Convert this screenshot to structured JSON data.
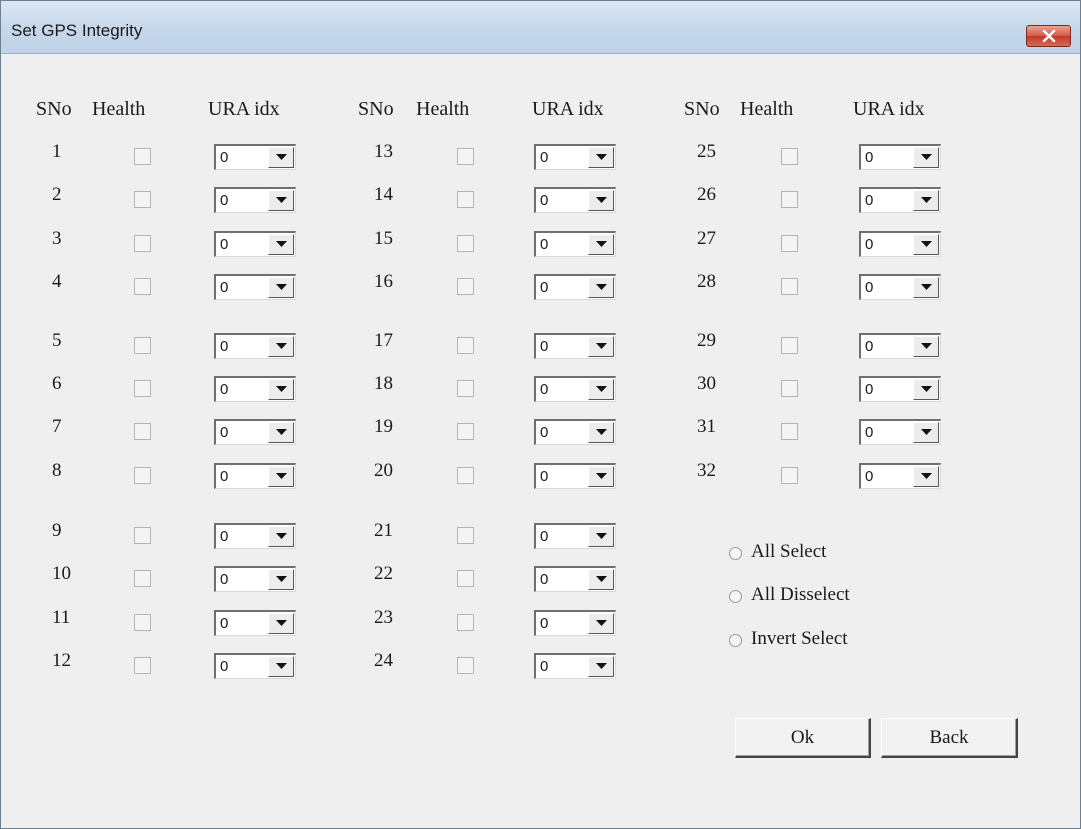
{
  "window": {
    "title": "Set GPS Integrity"
  },
  "headers": {
    "sno": "SNo",
    "health": "Health",
    "ura": "URA idx"
  },
  "satellites": [
    {
      "sno": "1",
      "health": false,
      "ura": "0"
    },
    {
      "sno": "2",
      "health": false,
      "ura": "0"
    },
    {
      "sno": "3",
      "health": false,
      "ura": "0"
    },
    {
      "sno": "4",
      "health": false,
      "ura": "0"
    },
    {
      "sno": "5",
      "health": false,
      "ura": "0"
    },
    {
      "sno": "6",
      "health": false,
      "ura": "0"
    },
    {
      "sno": "7",
      "health": false,
      "ura": "0"
    },
    {
      "sno": "8",
      "health": false,
      "ura": "0"
    },
    {
      "sno": "9",
      "health": false,
      "ura": "0"
    },
    {
      "sno": "10",
      "health": false,
      "ura": "0"
    },
    {
      "sno": "11",
      "health": false,
      "ura": "0"
    },
    {
      "sno": "12",
      "health": false,
      "ura": "0"
    },
    {
      "sno": "13",
      "health": false,
      "ura": "0"
    },
    {
      "sno": "14",
      "health": false,
      "ura": "0"
    },
    {
      "sno": "15",
      "health": false,
      "ura": "0"
    },
    {
      "sno": "16",
      "health": false,
      "ura": "0"
    },
    {
      "sno": "17",
      "health": false,
      "ura": "0"
    },
    {
      "sno": "18",
      "health": false,
      "ura": "0"
    },
    {
      "sno": "19",
      "health": false,
      "ura": "0"
    },
    {
      "sno": "20",
      "health": false,
      "ura": "0"
    },
    {
      "sno": "21",
      "health": false,
      "ura": "0"
    },
    {
      "sno": "22",
      "health": false,
      "ura": "0"
    },
    {
      "sno": "23",
      "health": false,
      "ura": "0"
    },
    {
      "sno": "24",
      "health": false,
      "ura": "0"
    },
    {
      "sno": "25",
      "health": false,
      "ura": "0"
    },
    {
      "sno": "26",
      "health": false,
      "ura": "0"
    },
    {
      "sno": "27",
      "health": false,
      "ura": "0"
    },
    {
      "sno": "28",
      "health": false,
      "ura": "0"
    },
    {
      "sno": "29",
      "health": false,
      "ura": "0"
    },
    {
      "sno": "30",
      "health": false,
      "ura": "0"
    },
    {
      "sno": "31",
      "health": false,
      "ura": "0"
    },
    {
      "sno": "32",
      "health": false,
      "ura": "0"
    }
  ],
  "selection": {
    "options": [
      "All Select",
      "All Disselect",
      "Invert Select"
    ],
    "selected": null
  },
  "buttons": {
    "ok": "Ok",
    "back": "Back"
  },
  "icons": {
    "close": "close-icon",
    "dropdown": "chevron-down-icon"
  },
  "colors": {
    "titlebar": "#c6d7ea",
    "close_button": "#c0392b",
    "window_bg": "#efefef"
  }
}
